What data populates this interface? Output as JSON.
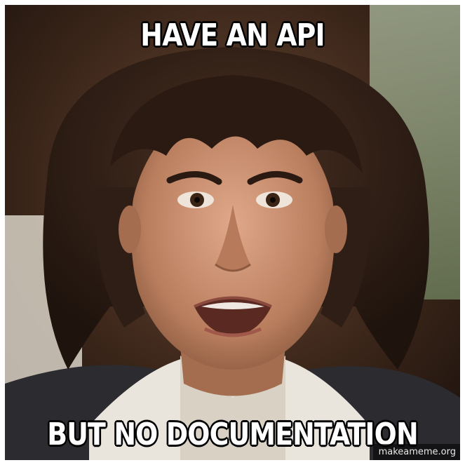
{
  "meme": {
    "top_text": "HAVE AN API",
    "bottom_text": "BUT NO DOCUMENTATION",
    "watermark": "makeameme.org"
  },
  "colors": {
    "caption_fill": "#ffffff",
    "caption_outline": "#000000",
    "background": "#3a2a22",
    "hair": "#2a1a12",
    "skin": "#c9926e"
  }
}
